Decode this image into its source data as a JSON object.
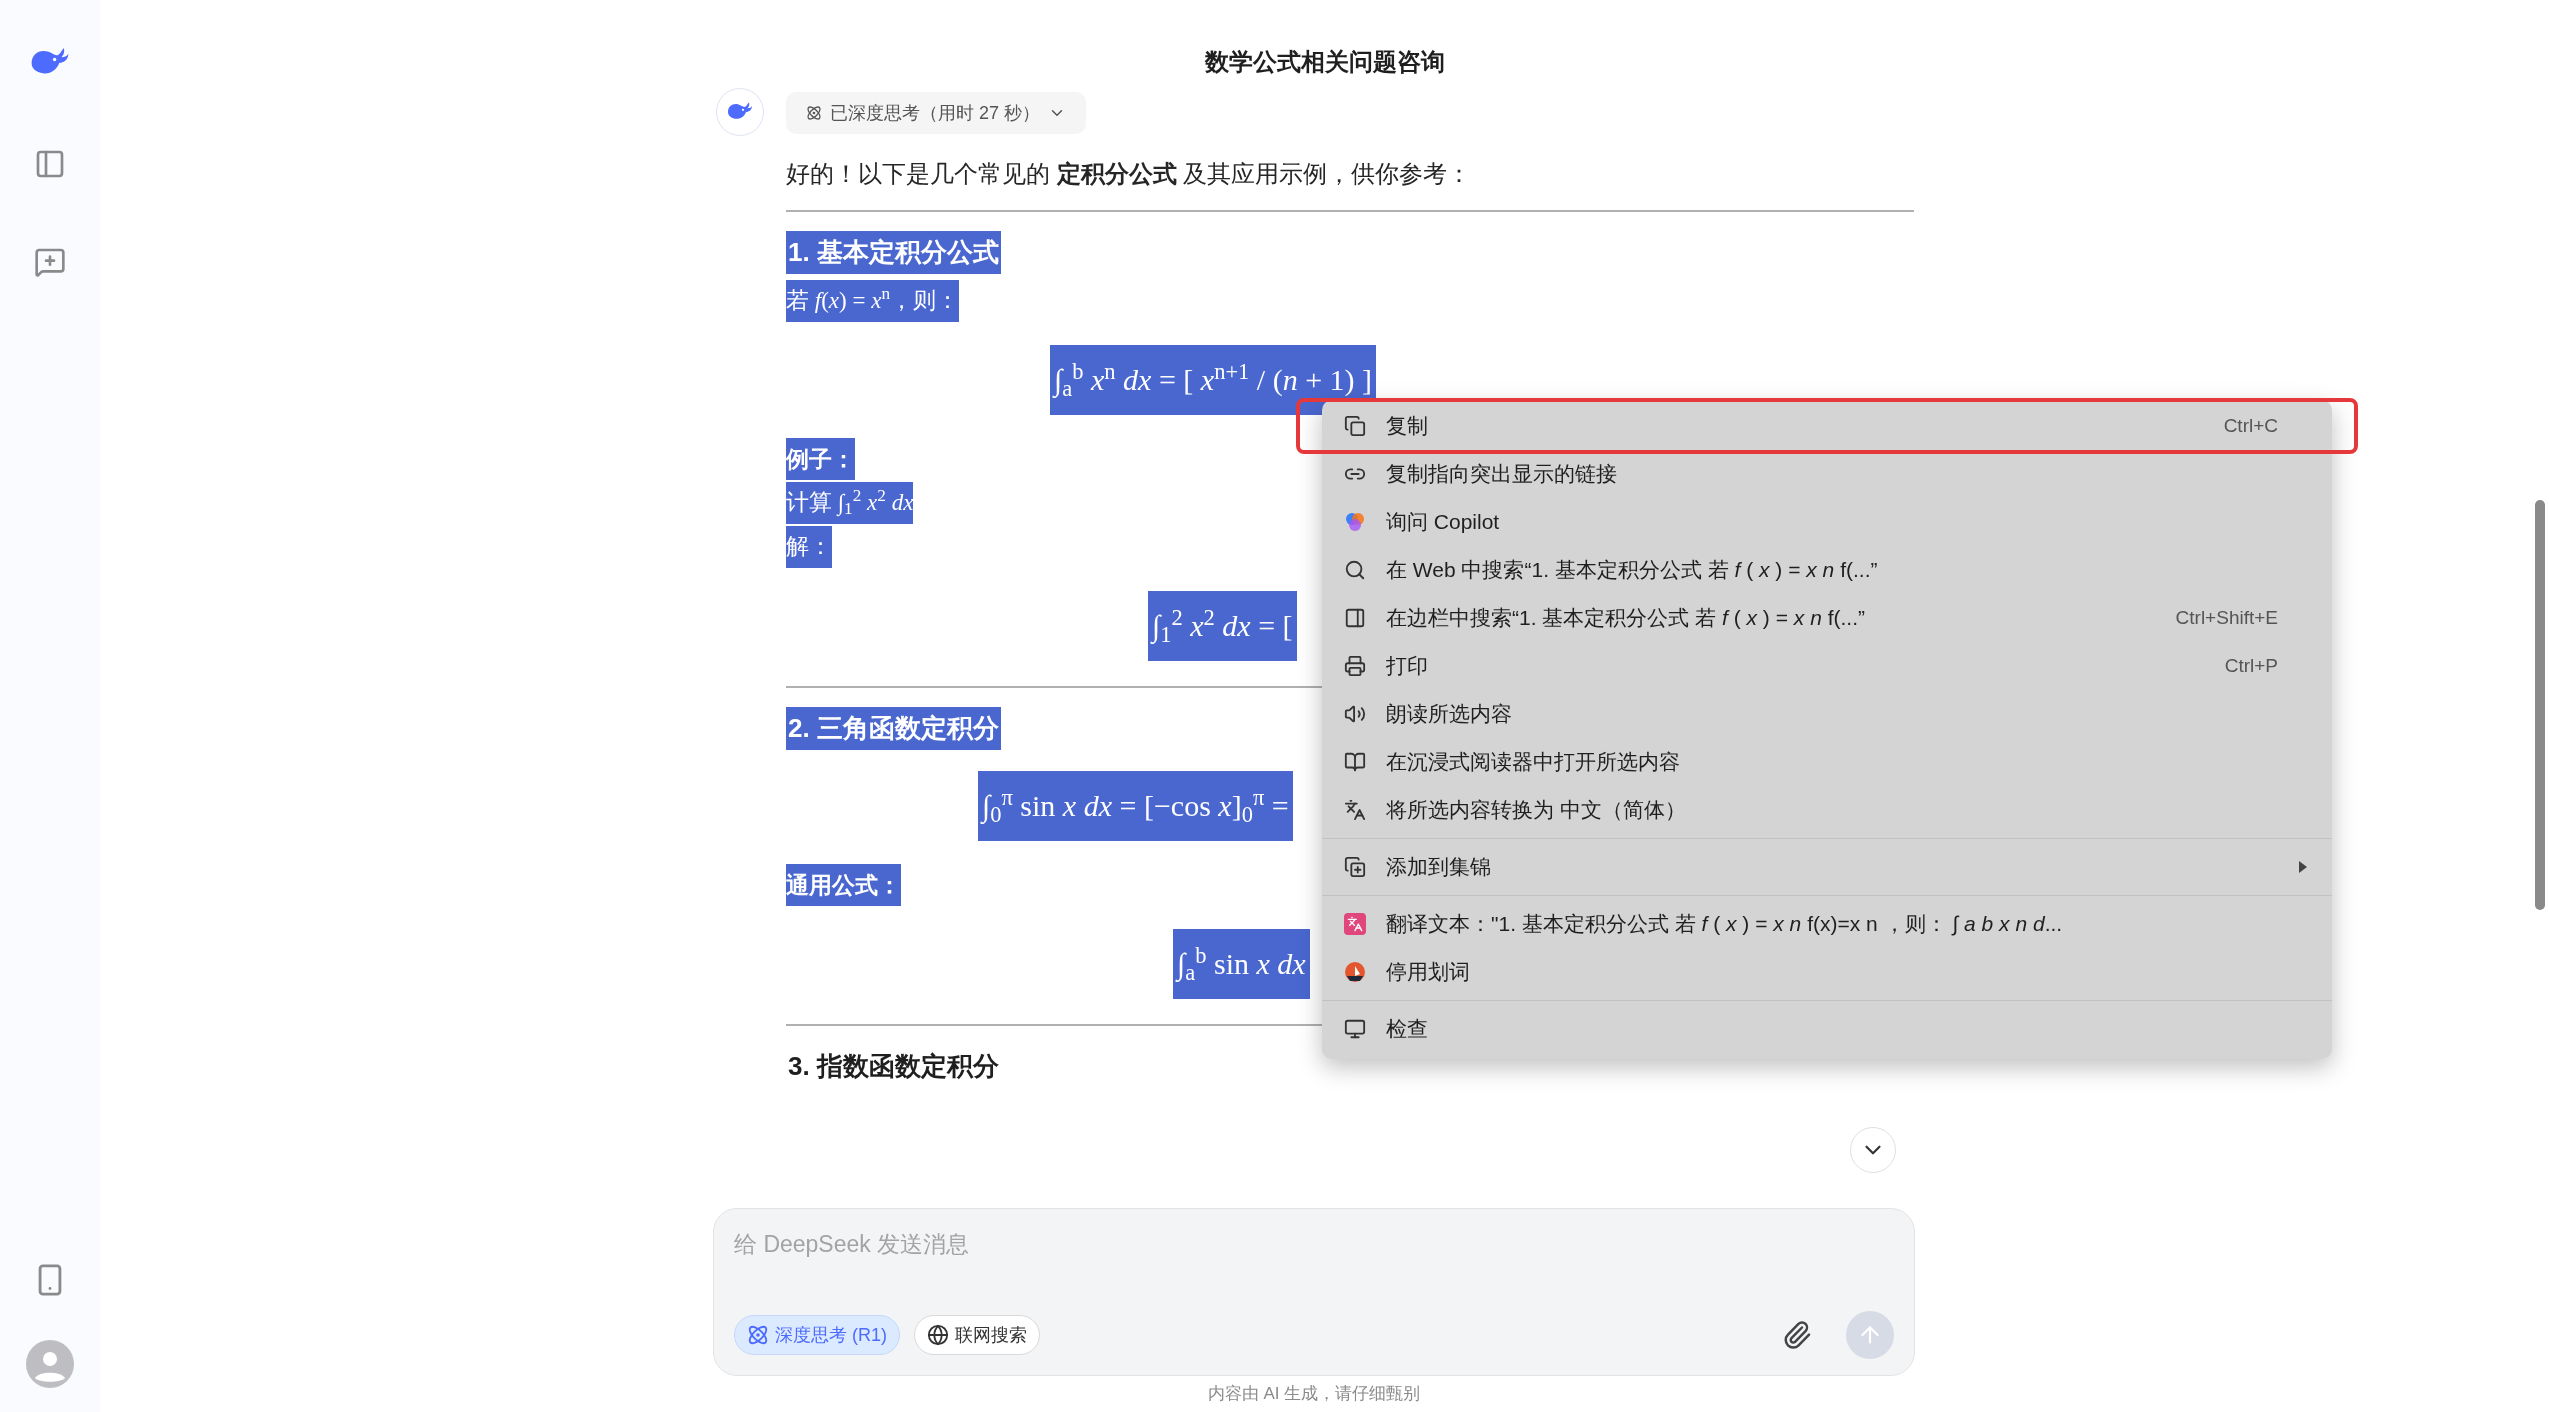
{
  "title": "数学公式相关问题咨询",
  "thinking": {
    "label": "已深度思考（用时 27 秒）",
    "expanded": false
  },
  "intro": "好的！以下是几个常见的 **定积分公式** 及其应用示例，供你参考：",
  "blocks": [
    {
      "kind": "heading",
      "text": "1. 基本定积分公式",
      "selected": true
    },
    {
      "kind": "para",
      "text": "若 *f*(*x*) = *x*$^{n}$，则：",
      "selected": true
    },
    {
      "kind": "formula",
      "text": "∫$_{a}$$^{b}$ *x*$^{n}$ *dx* = [ *x*$^{n+1}$ / (*n* + 1) ]",
      "selected": true
    },
    {
      "kind": "label",
      "text": "例子：",
      "selected": true
    },
    {
      "kind": "para",
      "text": "计算 ∫$_{1}$$^{2}$ *x*$^{2}$ *dx*",
      "selected": true
    },
    {
      "kind": "para",
      "text": "解：",
      "selected": true
    },
    {
      "kind": "formula",
      "text": "∫$_{1}$$^{2}$ *x*$^{2}$ *dx* = [",
      "selected": true
    },
    {
      "kind": "rule"
    },
    {
      "kind": "heading",
      "text": "2. 三角函数定积分",
      "selected": true
    },
    {
      "kind": "formula",
      "text": "∫$_{0}$$^{π}$ sin *x* *dx* = [−cos *x*]$_{0}$$^{π}$ =",
      "selected": true
    },
    {
      "kind": "label",
      "text": "通用公式：",
      "selected": true
    },
    {
      "kind": "formula",
      "text": "∫$_{a}$$^{b}$ sin *x* *dx*",
      "selected": true
    },
    {
      "kind": "rule"
    },
    {
      "kind": "heading",
      "text": "3. 指数函数定积分",
      "selected": false
    }
  ],
  "menu": {
    "groups": [
      [
        {
          "label": "复制",
          "shortcut": "Ctrl+C",
          "highlighted": true
        },
        {
          "label": "复制指向突出显示的链接",
          "highlighted": false
        },
        {
          "label": "询问 Copilot",
          "highlighted": false
        },
        {
          "label": "在 Web 中搜索“1. 基本定积分公式 若 *f* ( *x* ) = *x* *n* f(...”",
          "highlighted": false
        },
        {
          "label": "在边栏中搜索“1. 基本定积分公式 若 *f* ( *x* ) = *x* *n* f(...”",
          "shortcut": "Ctrl+Shift+E",
          "highlighted": false
        },
        {
          "label": "打印",
          "shortcut": "Ctrl+P",
          "highlighted": false
        },
        {
          "label": "朗读所选内容",
          "highlighted": false
        },
        {
          "label": "在沉浸式阅读器中打开所选内容",
          "highlighted": false
        },
        {
          "label": "将所选内容转换为 中文（简体）",
          "highlighted": false
        }
      ],
      [
        {
          "label": "添加到集锦",
          "submenu": true,
          "highlighted": false
        }
      ],
      [
        {
          "label": "翻译文本：\"1. 基本定积分公式 若 *f* ( *x* ) = *x* *n* f(x)=x  n  ，则：  ∫ *a* *b* *x* *n*   *d*...",
          "highlighted": false
        },
        {
          "label": "停用划词",
          "highlighted": false
        }
      ],
      [
        {
          "label": "检查",
          "highlighted": false
        }
      ]
    ]
  },
  "composer": {
    "placeholder": "给 DeepSeek 发送消息",
    "toggles": [
      {
        "label": "深度思考 (R1)",
        "selected": true
      },
      {
        "label": "联网搜索",
        "selected": false
      }
    ]
  },
  "footer": "内容由 AI 生成，请仔细甄别"
}
